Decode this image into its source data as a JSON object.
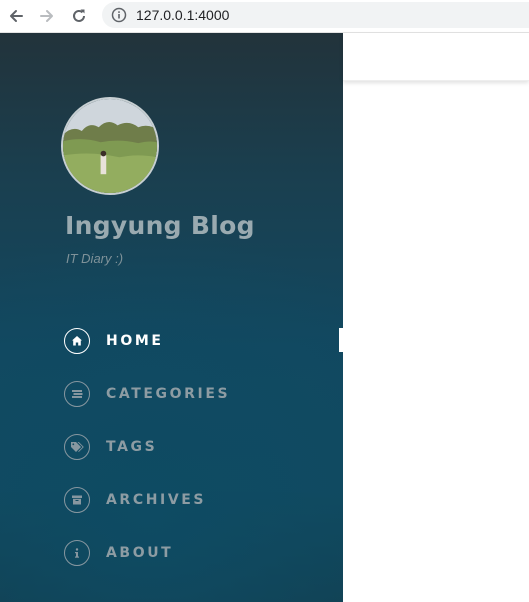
{
  "browser": {
    "url": "127.0.0.1:4000",
    "back_icon": "arrow-left-icon",
    "forward_icon": "arrow-right-icon",
    "reload_icon": "reload-icon",
    "info_icon": "info-icon"
  },
  "sidebar": {
    "title": "Ingyung Blog",
    "subtitle": "IT Diary :)",
    "avatar_icon": "profile-photo",
    "nav": [
      {
        "label": "HOME",
        "icon": "home-icon",
        "active": true
      },
      {
        "label": "CATEGORIES",
        "icon": "stream-icon",
        "active": false
      },
      {
        "label": "TAGS",
        "icon": "tags-icon",
        "active": false
      },
      {
        "label": "ARCHIVES",
        "icon": "archive-icon",
        "active": false
      },
      {
        "label": "ABOUT",
        "icon": "info-icon",
        "active": false
      }
    ]
  },
  "colors": {
    "sidebar_top": "#22333b",
    "sidebar_mid": "#124860",
    "nav_text": "#8d9ca3",
    "nav_active": "#ffffff"
  }
}
